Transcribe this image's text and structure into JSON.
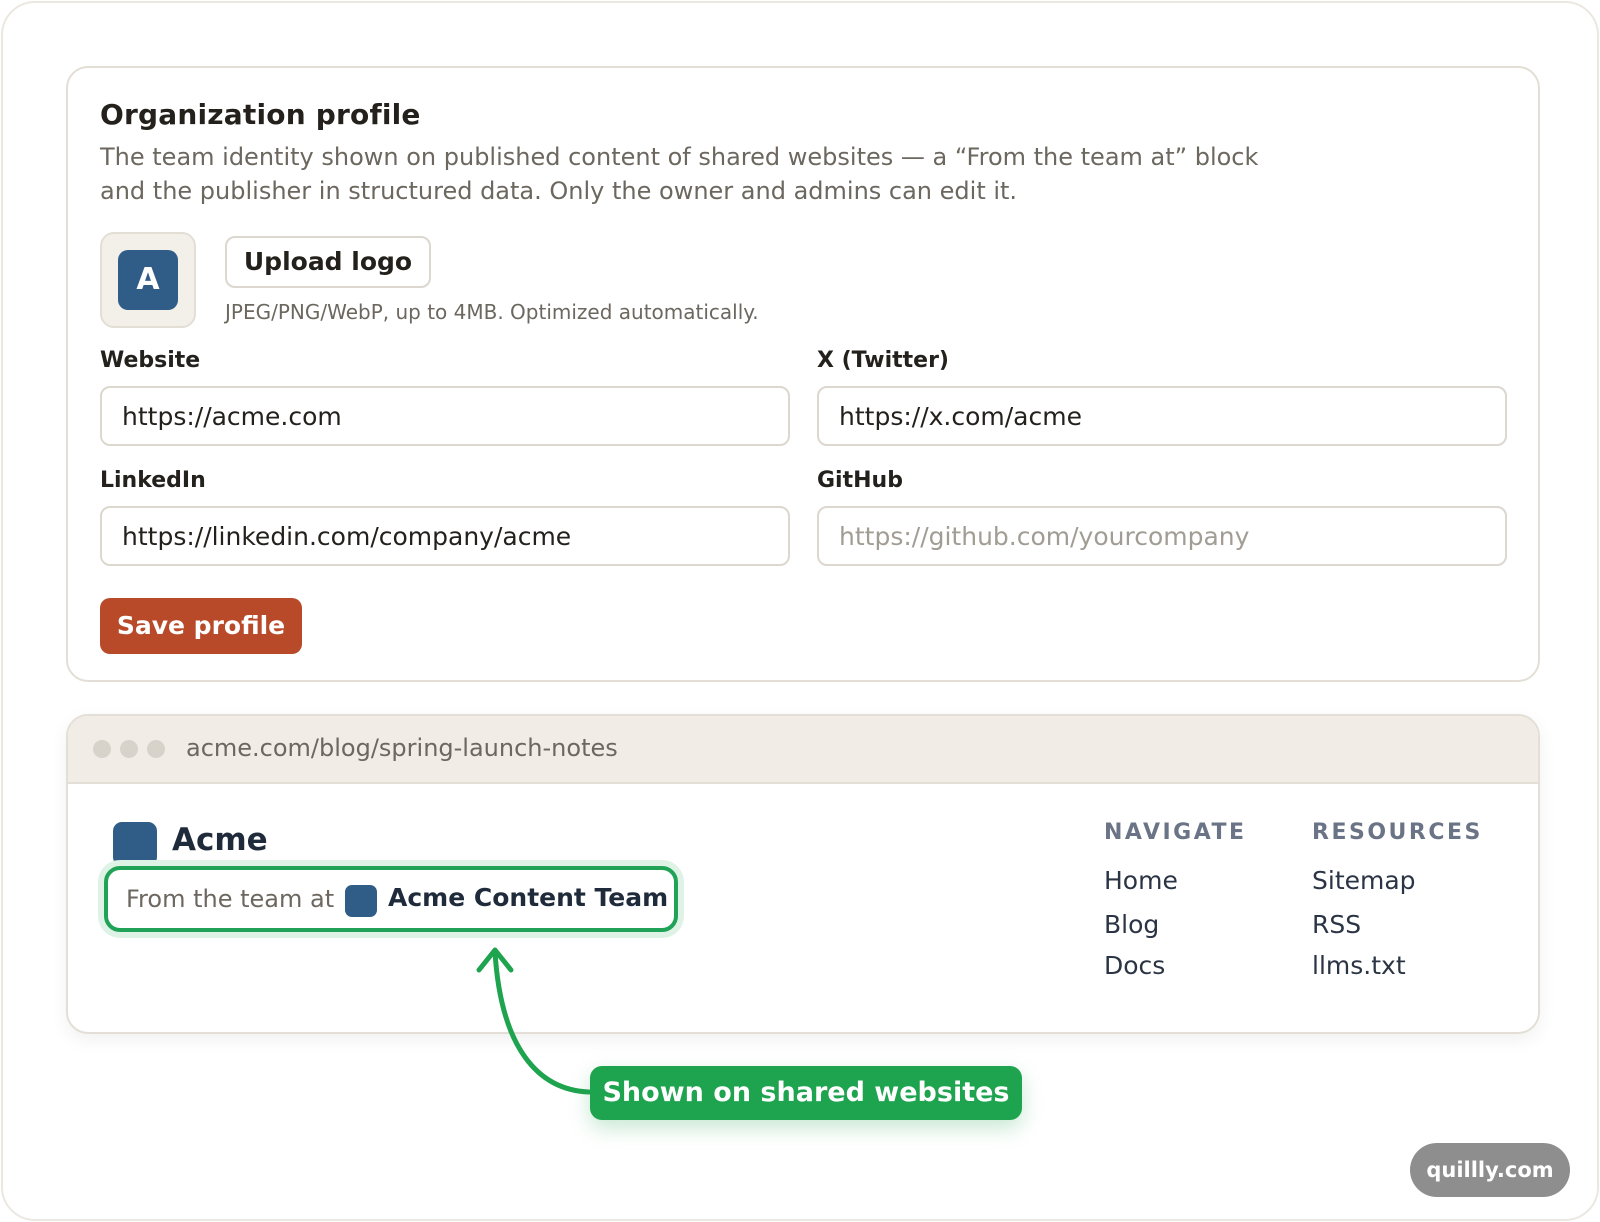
{
  "profile": {
    "title": "Organization profile",
    "description": "The team identity shown on published content of shared websites — a “From the team at” block and the publisher in structured data. Only the owner and admins can edit it.",
    "logo_letter": "A",
    "upload_label": "Upload logo",
    "upload_hint": "JPEG/PNG/WebP, up to 4MB. Optimized automatically.",
    "fields": {
      "website": {
        "label": "Website",
        "value": "https://acme.com",
        "placeholder": ""
      },
      "twitter": {
        "label": "X (Twitter)",
        "value": "https://x.com/acme",
        "placeholder": ""
      },
      "linkedin": {
        "label": "LinkedIn",
        "value": "https://linkedin.com/company/acme",
        "placeholder": ""
      },
      "github": {
        "label": "GitHub",
        "value": "",
        "placeholder": "https://github.com/yourcompany"
      }
    },
    "save_label": "Save profile"
  },
  "preview": {
    "url": "acme.com/blog/spring-launch-notes",
    "site_name": "Acme",
    "team_prefix": "From the team at",
    "team_name": "Acme Content Team",
    "nav": {
      "heading": "NAVIGATE",
      "links": [
        "Home",
        "Blog",
        "Docs"
      ]
    },
    "resources": {
      "heading": "RESOURCES",
      "links": [
        "Sitemap",
        "RSS",
        "llms.txt"
      ]
    }
  },
  "callout": {
    "text": "Shown on shared websites"
  },
  "watermark": {
    "text": "quillly.com"
  },
  "colors": {
    "accent": "#b84a2a",
    "brand_blue": "#2f5d88",
    "highlight_green": "#1ea34e"
  },
  "icons": {
    "logo": "letter-avatar-icon",
    "browser_dots": "window-dots-icon",
    "arrow": "curved-arrow-icon"
  }
}
